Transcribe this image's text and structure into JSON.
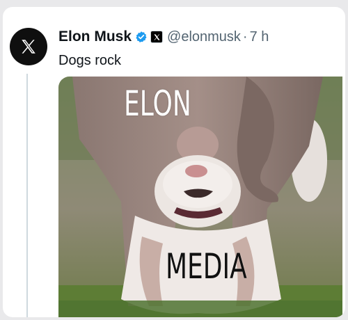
{
  "tweet": {
    "author_name": "Elon Musk",
    "handle": "@elonmusk",
    "separator": "·",
    "time": "7 h",
    "text": "Dogs rock",
    "avatar_icon": "x-logo-icon",
    "verified_icon": "verified-badge-icon",
    "affiliate_icon": "x-affiliate-badge-icon",
    "verified_color": "#1d9bf0"
  },
  "media": {
    "top_caption": "ELON",
    "bottom_caption": "MEDIA"
  }
}
